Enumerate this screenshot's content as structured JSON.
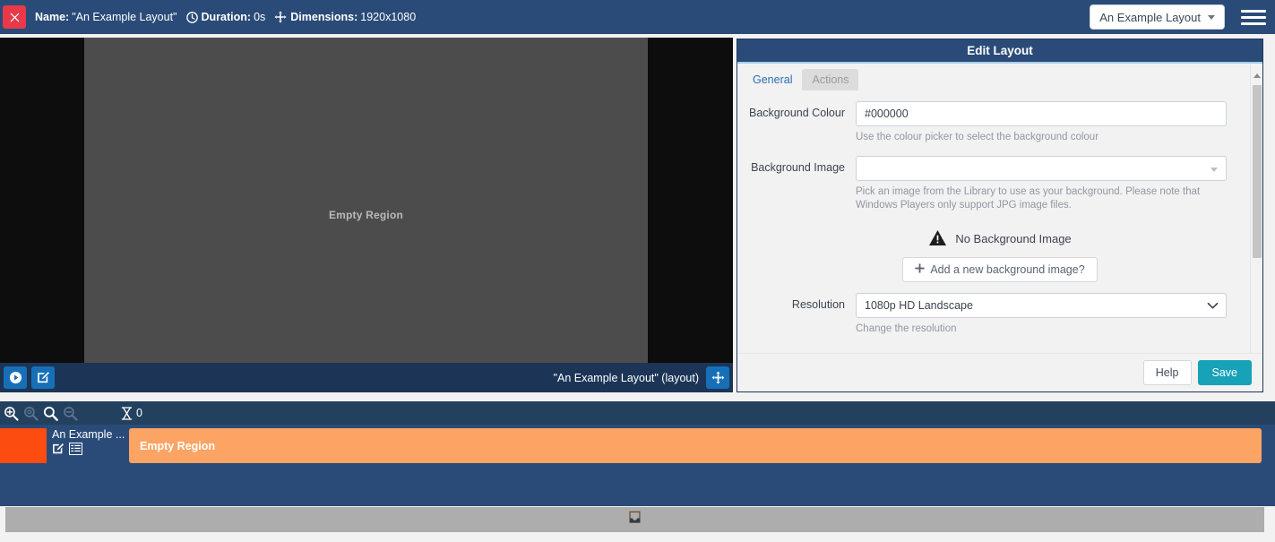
{
  "header": {
    "close_icon": "close-icon",
    "name_label": "Name:",
    "name_value": "\"An Example Layout\"",
    "clock_icon": "clock-icon",
    "duration_label": "Duration:",
    "duration_value": "0s",
    "arrows_icon": "arrows-icon",
    "dimensions_label": "Dimensions:",
    "dimensions_value": "1920x1080",
    "layout_select_value": "An Example Layout",
    "menu_icon": "hamburger-menu-icon"
  },
  "preview": {
    "region_label": "Empty Region",
    "background_colour": "#000000",
    "region_colour": "#4c4c4c",
    "toolbar": {
      "play_icon": "play-circle-icon",
      "edit_icon": "edit-pencil-icon",
      "name": "\"An Example Layout\" (layout)",
      "move_icon": "move-arrows-icon"
    }
  },
  "edit_panel": {
    "title": "Edit Layout",
    "tabs": [
      {
        "label": "General",
        "active": true
      },
      {
        "label": "Actions",
        "active": false
      }
    ],
    "fields": {
      "background_colour": {
        "label": "Background Colour",
        "value": "#000000",
        "help": "Use the colour picker to select the background colour"
      },
      "background_image": {
        "label": "Background Image",
        "value": "",
        "placeholder": "",
        "help": "Pick an image from the Library to use as your background. Please note that Windows Players only support JPG image files."
      },
      "resolution": {
        "label": "Resolution",
        "value": "1080p HD Landscape",
        "help": "Change the resolution",
        "options": [
          "1080p HD Landscape"
        ]
      }
    },
    "no_background": {
      "warning_icon": "warning-triangle-icon",
      "text": "No Background Image",
      "add_icon": "plus-icon",
      "add_label": "Add a new background image?"
    },
    "footer": {
      "help_label": "Help",
      "save_label": "Save",
      "save_colour": "#17a2b8"
    }
  },
  "timeline": {
    "toolbar": {
      "zoom_in_icon": "zoom-in-icon",
      "zoom_in_alt_icon": "zoom-in-disabled-icon",
      "search_icon": "search-icon",
      "zoom_out_icon": "zoom-out-icon",
      "hourglass_icon": "hourglass-icon",
      "duration_value": "0"
    },
    "row": {
      "swatch_colour": "#fd4c10",
      "name": "An Example ...",
      "edit_icon": "edit-pencil-icon",
      "list_icon": "list-icon",
      "bar_label": "Empty Region",
      "bar_colour": "#fca464"
    }
  },
  "bottom_bar": {
    "handle_icon": "inbox-collapse-icon"
  }
}
